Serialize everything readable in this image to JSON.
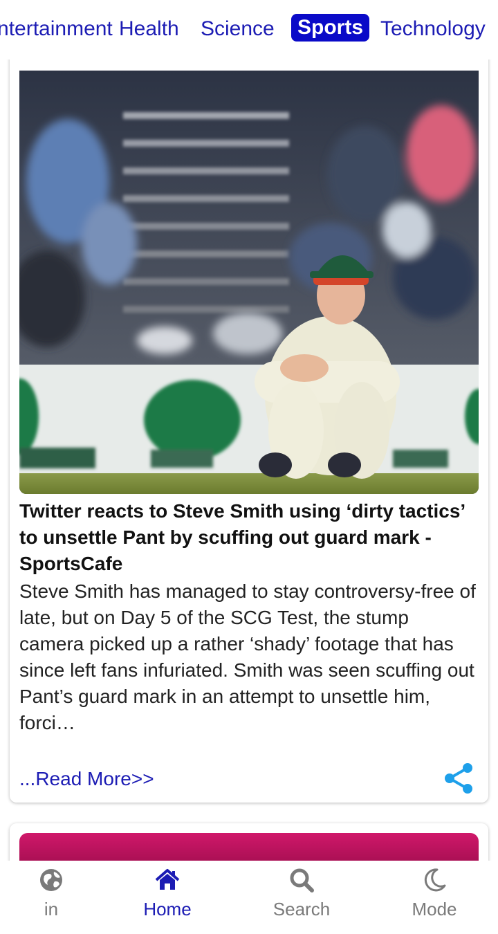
{
  "tabs": [
    {
      "label": "Entertainment",
      "active": false
    },
    {
      "label": "Health",
      "active": false
    },
    {
      "label": "Science",
      "active": false
    },
    {
      "label": "Sports",
      "active": true
    },
    {
      "label": "Technology",
      "active": false
    }
  ],
  "article": {
    "title": "Twitter reacts to Steve Smith using ‘dirty tactics’ to unsettle Pant by scuffing out guard mark - SportsCafe",
    "description": "Steve Smith has managed to stay controversy-free of late, but on Day 5 of the SCG Test, the stump camera picked up a rather ‘shady’ footage that has since left fans infuriated. Smith was seen scuffing out Pant’s guard mark in an attempt to unsettle him, forci…",
    "read_more": "...Read More>>",
    "share_icon": "share-icon",
    "image_alt": "Cricketer in whites and green cap seated on the grass"
  },
  "bottom_nav": [
    {
      "label": "in",
      "icon": "globe-icon",
      "active": false
    },
    {
      "label": "Home",
      "icon": "home-icon",
      "active": true
    },
    {
      "label": "Search",
      "icon": "search-icon",
      "active": false
    },
    {
      "label": "Mode",
      "icon": "moon-icon",
      "active": false
    }
  ],
  "colors": {
    "accent": "#1c1cb4",
    "active_tab_bg": "#0a0ac8",
    "share": "#1ea0ea",
    "inactive_nav": "#7a7a7a"
  }
}
